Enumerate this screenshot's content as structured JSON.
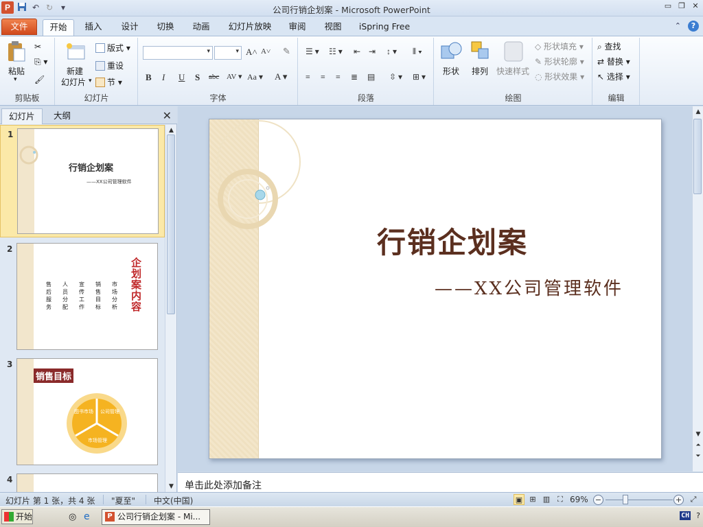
{
  "window": {
    "title": "公司行销企划案 - Microsoft PowerPoint",
    "app_icon": "P",
    "controls": [
      "minimize-icon",
      "restore-icon",
      "close-icon"
    ]
  },
  "qat": {
    "save": "save-icon",
    "undo": "undo-icon",
    "redo": "redo-icon",
    "customize": "customize-icon"
  },
  "tabs": [
    {
      "label": "文件",
      "kind": "file"
    },
    {
      "label": "开始",
      "kind": "active"
    },
    {
      "label": "插入"
    },
    {
      "label": "设计"
    },
    {
      "label": "切换"
    },
    {
      "label": "动画"
    },
    {
      "label": "幻灯片放映"
    },
    {
      "label": "审阅"
    },
    {
      "label": "视图"
    },
    {
      "label": "iSpring Free"
    }
  ],
  "ribbon": {
    "clipboard": {
      "label": "剪贴板",
      "paste": "粘贴"
    },
    "slides": {
      "label": "幻灯片",
      "new_slide_1": "新建",
      "new_slide_2": "幻灯片",
      "layout": "版式",
      "reset": "重设",
      "section": "节"
    },
    "font": {
      "label": "字体",
      "font_name": "",
      "font_size": ""
    },
    "paragraph": {
      "label": "段落"
    },
    "drawing": {
      "label": "绘图",
      "shapes": "形状",
      "arrange": "排列",
      "quick_styles": "快速样式",
      "shape_fill": "形状填充",
      "shape_outline": "形状轮廓",
      "shape_effects": "形状效果"
    },
    "editing": {
      "label": "编辑",
      "find": "查找",
      "replace": "替换",
      "select": "选择"
    }
  },
  "left_panel": {
    "tabs": [
      "幻灯片",
      "大纲"
    ],
    "slides": [
      {
        "num": "1",
        "title": "行销企划案",
        "subtitle": "——XX公司管理软件"
      },
      {
        "num": "2",
        "title": "企划案内容",
        "columns": [
          "售后服务",
          "人员分配",
          "宣传工作",
          "销售目标",
          "市场分析"
        ]
      },
      {
        "num": "3",
        "title": "销售目标",
        "segments": [
          "图书市场",
          "公司管理",
          "市场管理"
        ]
      },
      {
        "num": "4"
      }
    ]
  },
  "slide": {
    "title": "行销企划案",
    "subtitle": "——XX公司管理软件"
  },
  "notes": {
    "placeholder": "单击此处添加备注"
  },
  "status": {
    "slide_info": "幻灯片 第 1 张，共 4 张",
    "theme": "\"夏至\"",
    "language": "中文(中国)",
    "zoom": "69%",
    "zoom_level": 0.69
  },
  "taskbar": {
    "start": "开始",
    "task": "公司行销企划案 - Mi...",
    "ime": "CH"
  },
  "colors": {
    "accent": "#d35230",
    "slide_text": "#5b2f1f",
    "ribbon_bg": "#e4ecf6",
    "selection": "#fbe9a8"
  }
}
